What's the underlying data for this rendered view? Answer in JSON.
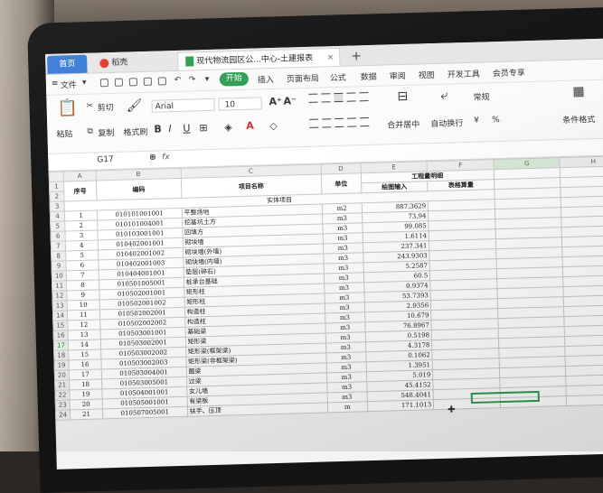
{
  "tabs": {
    "home": "首页",
    "shell": "稻壳",
    "document": "现代物流园区公...中心-土建报表",
    "new_tab": "+"
  },
  "menu": {
    "file": "文件",
    "start": "开始",
    "insert": "插入",
    "page_layout": "页面布局",
    "formula": "公式",
    "data": "数据",
    "review": "审阅",
    "view": "视图",
    "developer": "开发工具",
    "member": "会员专享"
  },
  "ribbon": {
    "cut": "剪切",
    "paste": "粘贴",
    "copy": "复制",
    "format_painter": "格式刷",
    "font_name": "Arial",
    "font_size": "10",
    "bold": "B",
    "italic": "I",
    "underline": "U",
    "increase_font": "A⁺",
    "decrease_font": "A⁻",
    "merge_center": "合并居中",
    "wrap_text": "自动换行",
    "number_format": "常规",
    "currency": "¥",
    "percent": "%",
    "conditional_format": "条件格式"
  },
  "formula_bar": {
    "cell_ref": "G17",
    "fx": "fx",
    "value": ""
  },
  "columns": [
    "A",
    "B",
    "C",
    "D",
    "E",
    "F",
    "G",
    "H"
  ],
  "header": {
    "seq": "序号",
    "code": "编码",
    "item_name": "项目名称",
    "unit": "单位",
    "quantity_group": "工程量明细",
    "drawing_input": "绘图输入",
    "table_input": "表格算量",
    "entity_items": "实体项目"
  },
  "rows": [
    {
      "seq": "1",
      "code": "010101001001",
      "name": "平整场地",
      "unit": "m2",
      "qty": "887.3629"
    },
    {
      "seq": "2",
      "code": "010101004001",
      "name": "挖基坑土方",
      "unit": "m3",
      "qty": "73.94"
    },
    {
      "seq": "3",
      "code": "010103001001",
      "name": "回填方",
      "unit": "m3",
      "qty": "99.085"
    },
    {
      "seq": "4",
      "code": "010402001001",
      "name": "砌块墙",
      "unit": "m3",
      "qty": "1.6114"
    },
    {
      "seq": "5",
      "code": "010402001002",
      "name": "砌块墙(外墙)",
      "unit": "m3",
      "qty": "237.341"
    },
    {
      "seq": "6",
      "code": "010402001003",
      "name": "砌块墙(内墙)",
      "unit": "m3",
      "qty": "243.9303"
    },
    {
      "seq": "7",
      "code": "010404001001",
      "name": "垫层(碎石)",
      "unit": "m3",
      "qty": "5.2587"
    },
    {
      "seq": "8",
      "code": "010501005001",
      "name": "桩承台基础",
      "unit": "m3",
      "qty": "60.5"
    },
    {
      "seq": "9",
      "code": "010502001001",
      "name": "矩形柱",
      "unit": "m3",
      "qty": "0.9374"
    },
    {
      "seq": "10",
      "code": "010502001002",
      "name": "矩形柱",
      "unit": "m3",
      "qty": "53.7393"
    },
    {
      "seq": "11",
      "code": "010502002001",
      "name": "构造柱",
      "unit": "m3",
      "qty": "2.9356"
    },
    {
      "seq": "12",
      "code": "010502002002",
      "name": "构造柱",
      "unit": "m3",
      "qty": "10.679"
    },
    {
      "seq": "13",
      "code": "010503001001",
      "name": "基础梁",
      "unit": "m3",
      "qty": "76.8967"
    },
    {
      "seq": "14",
      "code": "010503002001",
      "name": "矩形梁",
      "unit": "m3",
      "qty": "0.5198"
    },
    {
      "seq": "15",
      "code": "010503002002",
      "name": "矩形梁(框架梁)",
      "unit": "m3",
      "qty": "4.3178"
    },
    {
      "seq": "16",
      "code": "010503002003",
      "name": "矩形梁(非框架梁)",
      "unit": "m3",
      "qty": "0.1062"
    },
    {
      "seq": "17",
      "code": "010503004001",
      "name": "圈梁",
      "unit": "m3",
      "qty": "1.3951"
    },
    {
      "seq": "18",
      "code": "010503005001",
      "name": "过梁",
      "unit": "m3",
      "qty": "5.019"
    },
    {
      "seq": "19",
      "code": "010504001001",
      "name": "女儿墙",
      "unit": "m3",
      "qty": "45.4152"
    },
    {
      "seq": "20",
      "code": "010505001001",
      "name": "有梁板",
      "unit": "m3",
      "qty": "548.4041"
    },
    {
      "seq": "21",
      "code": "010507005001",
      "name": "扶手、压顶",
      "unit": "m",
      "qty": "171.1013"
    }
  ],
  "colors": {
    "accent_green": "#2e9d52",
    "home_tab": "#3b7bd6"
  }
}
